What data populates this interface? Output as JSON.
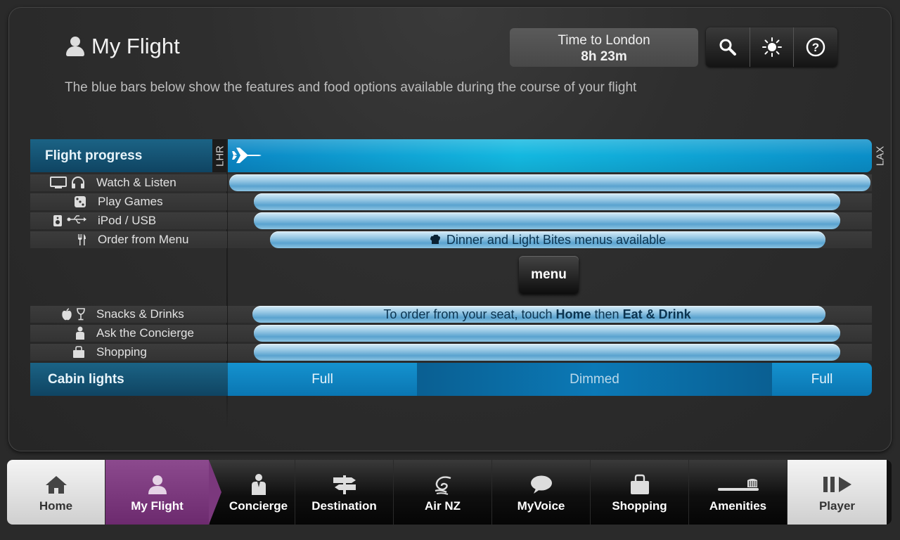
{
  "header": {
    "title": "My Flight",
    "subtitle": "The blue bars below show the features and food options available during the course of your flight"
  },
  "time_box": {
    "label": "Time to London",
    "value": "8h 23m"
  },
  "toolbar": {
    "icons": [
      "search-icon",
      "brightness-icon",
      "help-icon"
    ]
  },
  "flight_progress": {
    "label": "Flight progress",
    "origin": "LHR",
    "destination": "LAX",
    "progress": 0.0
  },
  "rows": {
    "watch_listen": {
      "label": "Watch & Listen"
    },
    "play_games": {
      "label": "Play Games"
    },
    "ipod_usb": {
      "label": "iPod / USB"
    },
    "order_menu": {
      "label": "Order from Menu",
      "bar_text": "Dinner and Light Bites menus available"
    },
    "snacks": {
      "label": "Snacks & Drinks",
      "bar_text_1": "To order from your seat, touch",
      "bar_bold_1": "Home",
      "bar_text_2": "then",
      "bar_bold_2": "Eat & Drink"
    },
    "concierge": {
      "label": "Ask the Concierge"
    },
    "shopping": {
      "label": "Shopping"
    }
  },
  "menu_button": {
    "label": "menu"
  },
  "cabin_lights": {
    "label": "Cabin lights",
    "segments": [
      "Full",
      "Dimmed",
      "Full"
    ]
  },
  "nav": {
    "home": "Home",
    "my_flight": "My Flight",
    "concierge": "Concierge",
    "destination": "Destination",
    "air_nz": "Air NZ",
    "my_voice": "MyVoice",
    "shopping": "Shopping",
    "amenities": "Amenities",
    "player": "Player"
  },
  "colors": {
    "accent_blue": "#0a8ec8",
    "active_nav": "#7b387d"
  }
}
